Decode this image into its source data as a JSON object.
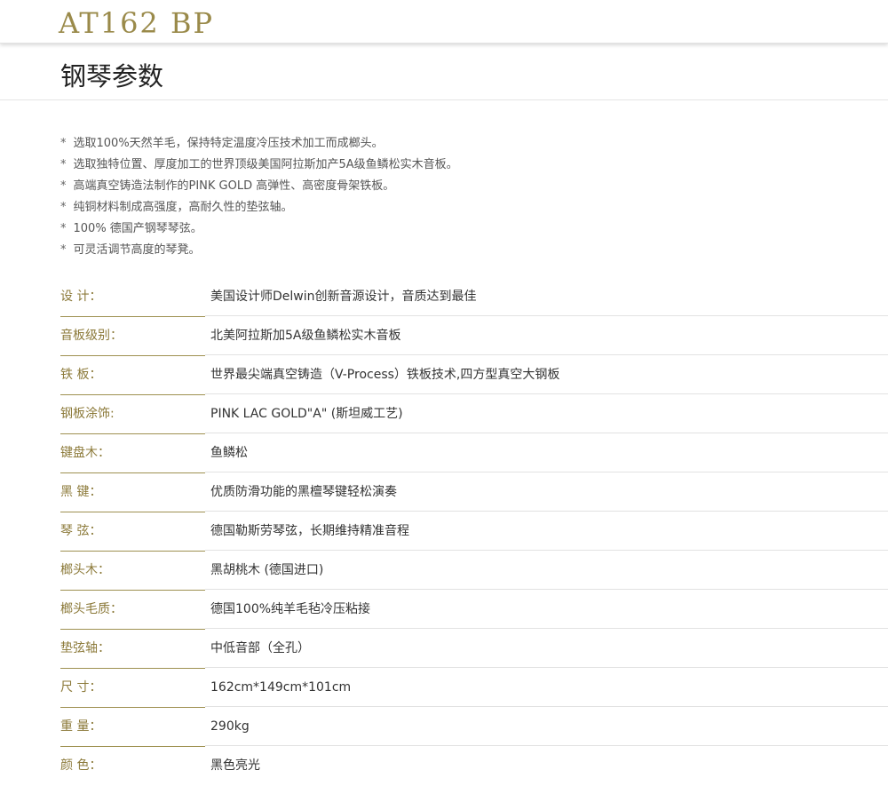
{
  "header": {
    "model": "AT162 BP"
  },
  "section": {
    "title": "钢琴参数"
  },
  "features": [
    "选取100%天然羊毛，保持特定温度冷压技术加工而成榔头。",
    "选取独特位置、厚度加工的世界顶级美国阿拉斯加产5A级鱼鳞松实木音板。",
    "高端真空铸造法制作的PINK GOLD 高弹性、高密度骨架铁板。",
    "纯铜材料制成高强度，高耐久性的垫弦轴。",
    "100% 德国产钢琴琴弦。",
    "可灵活调节高度的琴凳。"
  ],
  "feature_marker": "*",
  "specs": [
    {
      "label": "设 计：",
      "value": "美国设计师Delwin创新音源设计，音质达到最佳"
    },
    {
      "label": "音板级别：",
      "value": "北美阿拉斯加5A级鱼鳞松实木音板"
    },
    {
      "label": "铁 板：",
      "value": "世界最尖端真空铸造（V-Process）铁板技术,四方型真空大钢板"
    },
    {
      "label": "钢板涂饰:",
      "value": "PINK LAC GOLD\"A\" (斯坦威工艺)"
    },
    {
      "label": "键盘木：",
      "value": "鱼鳞松"
    },
    {
      "label": "黑 键：",
      "value": "优质防滑功能的黑檀琴键轻松演奏"
    },
    {
      "label": "琴 弦：",
      "value": "德国勒斯劳琴弦，长期维持精准音程"
    },
    {
      "label": "榔头木：",
      "value": "黑胡桃木 (德国进口)"
    },
    {
      "label": "榔头毛质：",
      "value": "德国100%纯羊毛毡冷压粘接"
    },
    {
      "label": "垫弦轴：",
      "value": "中低音部（全孔）"
    },
    {
      "label": "尺 寸：",
      "value": "162cm*149cm*101cm"
    },
    {
      "label": "重 量：",
      "value": "290kg"
    },
    {
      "label": "颜 色：",
      "value": "黑色亮光"
    }
  ],
  "colors": {
    "accent": "#9a8a4a",
    "label": "#8c7a3a",
    "label_rule": "#9e9050",
    "text": "#333333"
  }
}
